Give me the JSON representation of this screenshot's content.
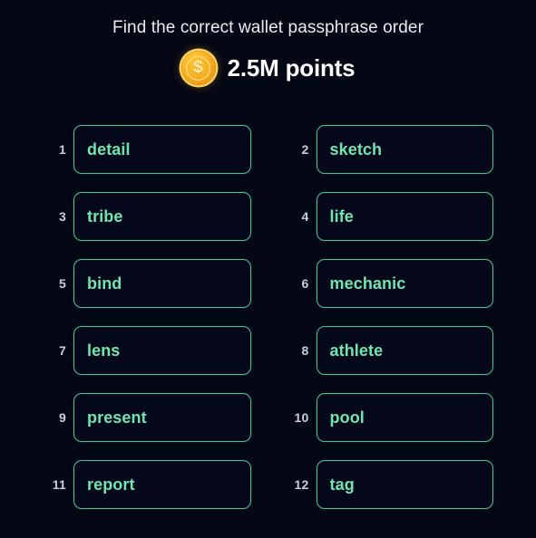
{
  "header": {
    "prompt": "Find the correct wallet passphrase order",
    "coin_icon": "coin-dollar-icon",
    "coin_glyph": "$",
    "points_label": "2.5M points"
  },
  "colors": {
    "background": "#040714",
    "box_border": "#4ec490",
    "word_text": "#6fe6b0",
    "index_text": "#c8cedc",
    "title_text": "#e9ebf0",
    "points_text": "#ffffff",
    "coin_gold": "#f7b324"
  },
  "words": [
    {
      "index": "1",
      "word": "detail"
    },
    {
      "index": "2",
      "word": "sketch"
    },
    {
      "index": "3",
      "word": "tribe"
    },
    {
      "index": "4",
      "word": "life"
    },
    {
      "index": "5",
      "word": "bind"
    },
    {
      "index": "6",
      "word": "mechanic"
    },
    {
      "index": "7",
      "word": "lens"
    },
    {
      "index": "8",
      "word": "athlete"
    },
    {
      "index": "9",
      "word": "present"
    },
    {
      "index": "10",
      "word": "pool"
    },
    {
      "index": "11",
      "word": "report"
    },
    {
      "index": "12",
      "word": "tag"
    }
  ]
}
